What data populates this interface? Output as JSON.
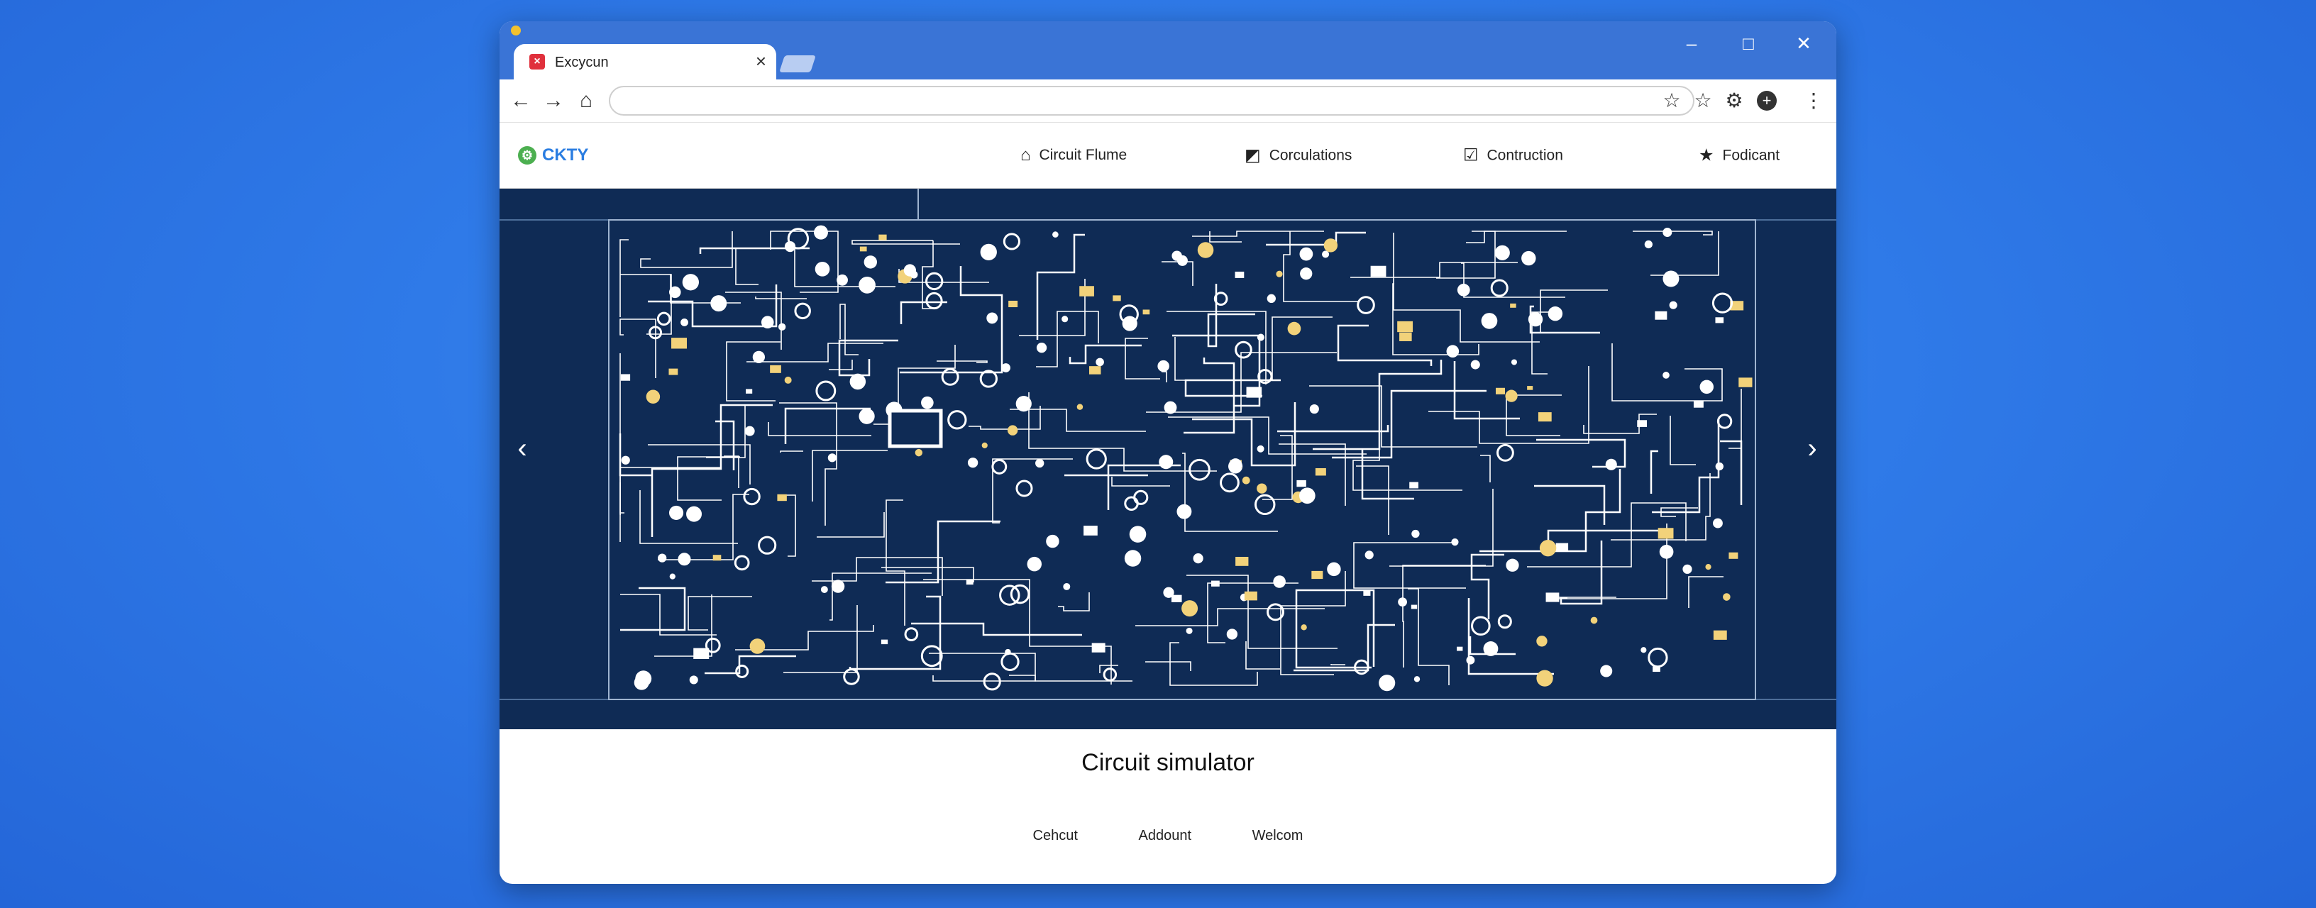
{
  "browser": {
    "tab_title": "Excycun",
    "tab_favicon": "close-square-icon",
    "address": ""
  },
  "site": {
    "logo_text": "CKTY",
    "nav": [
      {
        "label": "Circuit Flume",
        "icon": "home-icon"
      },
      {
        "label": "Corculations",
        "icon": "chip-icon"
      },
      {
        "label": "Contruction",
        "icon": "checkbox-icon"
      },
      {
        "label": "Fodicant",
        "icon": "star-icon"
      }
    ]
  },
  "hero": {
    "image": "circuit-diagram",
    "background": "#0f2b55"
  },
  "footer": {
    "title": "Circuit simulator",
    "links": [
      "Cehcut",
      "Addount",
      "Welcom"
    ]
  },
  "colors": {
    "desktop": "#2f7ae8",
    "titlebar": "#3a74d6",
    "accent": "#2a7de1",
    "circuit_bg": "#0f2b55",
    "circuit_line": "#ffffff",
    "circuit_highlight": "#f2d27a"
  }
}
